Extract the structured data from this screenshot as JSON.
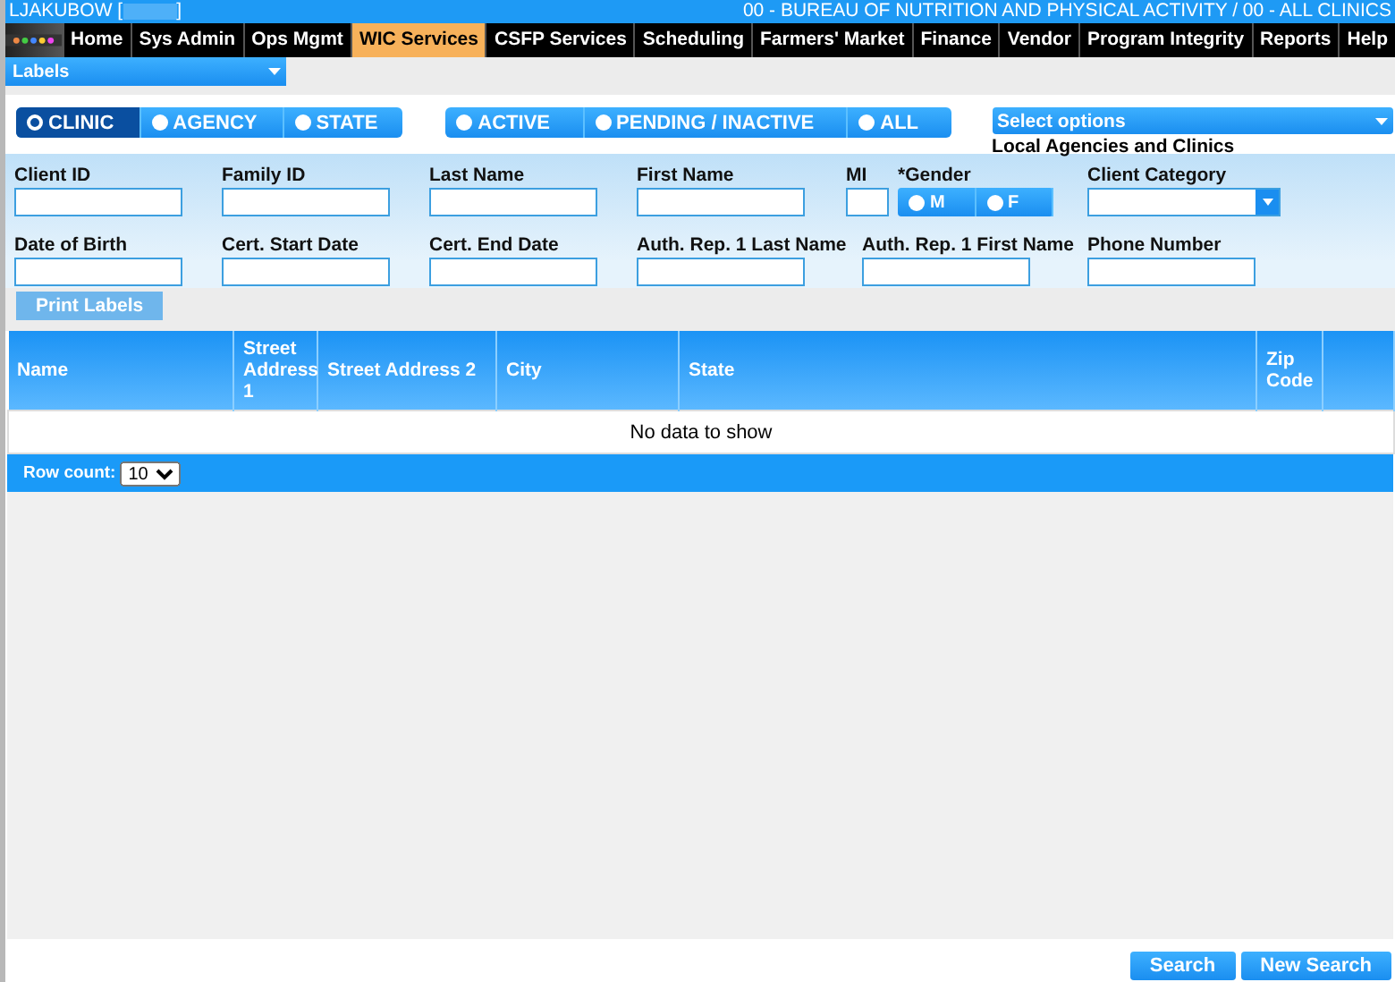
{
  "header": {
    "user_prefix": "LJAKUBOW [",
    "user_suffix": "]",
    "location": "00 - BUREAU OF NUTRITION AND PHYSICAL ACTIVITY / 00 - ALL CLINICS"
  },
  "nav": [
    {
      "label": "Home",
      "selected": false
    },
    {
      "label": "Sys Admin",
      "selected": false
    },
    {
      "label": "Ops Mgmt",
      "selected": false
    },
    {
      "label": "WIC Services",
      "selected": true
    },
    {
      "label": "CSFP Services",
      "selected": false
    },
    {
      "label": "Scheduling",
      "selected": false
    },
    {
      "label": "Farmers' Market",
      "selected": false
    },
    {
      "label": "Finance",
      "selected": false
    },
    {
      "label": "Vendor",
      "selected": false
    },
    {
      "label": "Program Integrity",
      "selected": false
    },
    {
      "label": "Reports",
      "selected": false
    },
    {
      "label": "Help",
      "selected": false
    }
  ],
  "page_menu": {
    "label": "Labels"
  },
  "scope_options": [
    {
      "label": "CLINIC",
      "selected": true
    },
    {
      "label": "AGENCY",
      "selected": false
    },
    {
      "label": "STATE",
      "selected": false
    }
  ],
  "status_options": [
    {
      "label": "ACTIVE",
      "selected": false
    },
    {
      "label": "PENDING / INACTIVE",
      "selected": false
    },
    {
      "label": "ALL",
      "selected": false
    }
  ],
  "agency_select": {
    "placeholder": "Select options",
    "caption": "Local Agencies and Clinics"
  },
  "fields": [
    [
      {
        "label": "Client ID",
        "kind": "text"
      },
      {
        "label": "Family ID",
        "kind": "text"
      },
      {
        "label": "Last Name",
        "kind": "text"
      },
      {
        "label": "First Name",
        "kind": "text"
      },
      {
        "label": "MI",
        "kind": "text"
      },
      {
        "label": "*Gender",
        "kind": "radio",
        "options": [
          {
            "label": "M",
            "selected": false
          },
          {
            "label": "F",
            "selected": false
          }
        ]
      },
      {
        "label": "Client Category",
        "kind": "select"
      }
    ],
    [
      {
        "label": "Date of Birth",
        "kind": "text"
      },
      {
        "label": "Cert. Start Date",
        "kind": "text"
      },
      {
        "label": "Cert. End Date",
        "kind": "text"
      },
      {
        "label": "Auth. Rep. 1 Last Name",
        "kind": "text"
      },
      {
        "label": "Auth. Rep. 1 First Name",
        "kind": "text"
      },
      {
        "label": "Phone Number",
        "kind": "text"
      }
    ]
  ],
  "print_button": {
    "label": "Print Labels",
    "disabled": true
  },
  "table": {
    "columns": [
      "Name",
      "Street Address 1",
      "Street Address 2",
      "City",
      "State",
      "Zip Code"
    ],
    "empty_message": "No data to show",
    "row_count_label": "Row count:",
    "row_count": "10"
  },
  "buttons": [
    {
      "label": "Search"
    },
    {
      "label": "New Search"
    }
  ]
}
